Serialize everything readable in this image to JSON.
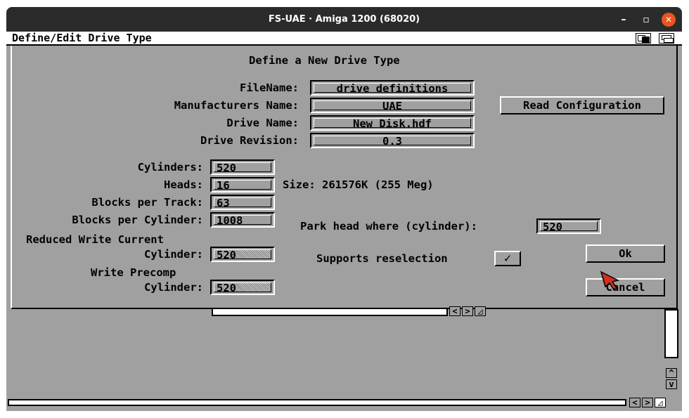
{
  "window": {
    "title": "FS-UAE · Amiga 1200 (68020)",
    "minimize_glyph": "–",
    "maximize_glyph": "▫",
    "close_glyph": "✕",
    "close_color": "#e95420"
  },
  "amiga_window": {
    "title": "Define/Edit Drive Type"
  },
  "dialog": {
    "heading": "Define a New Drive Type",
    "filename_label": "FileName:",
    "filename_value": "drive definitions",
    "manufacturer_label": "Manufacturers Name:",
    "manufacturer_value": "UAE",
    "drive_name_label": "Drive Name:",
    "drive_name_value": "New Disk.hdf",
    "drive_revision_label": "Drive Revision:",
    "drive_revision_value": "0.3",
    "read_config_button": "Read Configuration",
    "cylinders_label": "Cylinders:",
    "cylinders_value": "520",
    "heads_label": "Heads:",
    "heads_value": "16",
    "size_text": "Size: 261576K (255 Meg)",
    "blocks_per_track_label": "Blocks per Track:",
    "blocks_per_track_value": "63",
    "blocks_per_cylinder_label": "Blocks per Cylinder:",
    "blocks_per_cylinder_value": "1008",
    "park_head_label": "Park head where (cylinder):",
    "park_head_value": "520",
    "reduced_write_label_1": "Reduced Write Current",
    "reduced_write_label_2": "Cylinder:",
    "reduced_write_value": "520",
    "supports_reselection_label": "Supports reselection",
    "supports_reselection_checked": "✓",
    "write_precomp_label_1": "Write Precomp",
    "write_precomp_label_2": "Cylinder:",
    "write_precomp_value": "520",
    "ok_button": "Ok",
    "cancel_button": "Cancel"
  },
  "scroll": {
    "left_arrow": "<",
    "right_arrow": ">",
    "resize_glyph": "◿",
    "up_arrow": "^",
    "down_arrow": "v"
  },
  "colors": {
    "amiga_gray": "#a0a0a0",
    "pointer_red": "#d03020"
  }
}
